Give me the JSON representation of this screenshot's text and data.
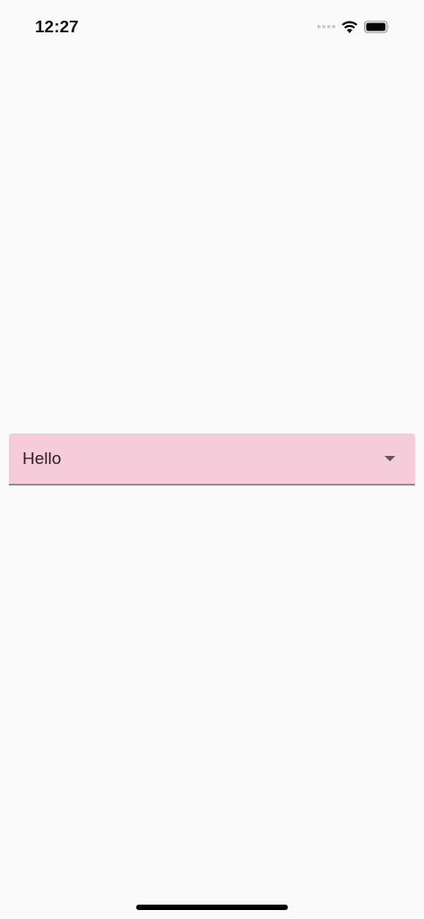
{
  "status_bar": {
    "time": "12:27"
  },
  "dropdown": {
    "value": "Hello"
  }
}
